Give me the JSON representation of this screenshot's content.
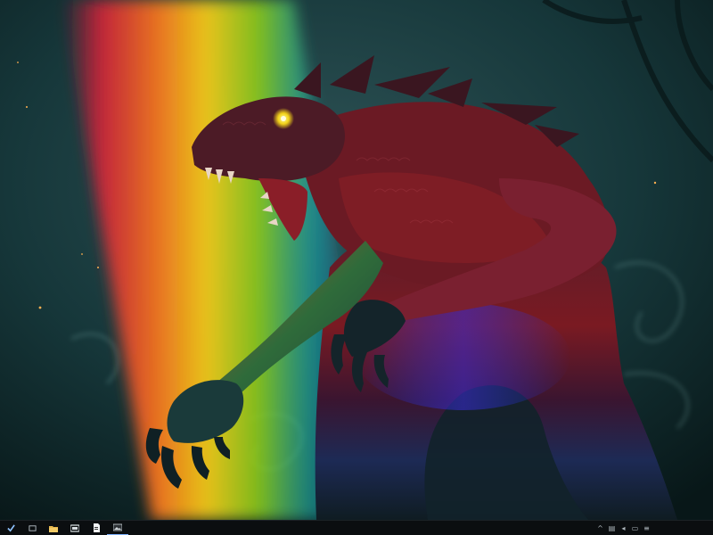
{
  "desktop": {
    "wallpaper_description_icon": "monster-wallpaper-icon"
  },
  "taskbar": {
    "start_icon": "start-menu-icon",
    "apps": [
      {
        "icon": "task-view-icon"
      },
      {
        "icon": "file-explorer-icon"
      },
      {
        "icon": "folder-icon"
      },
      {
        "icon": "document-icon"
      },
      {
        "icon": "photo-app-icon"
      }
    ],
    "tray": [
      {
        "icon": "chevron-up-icon",
        "glyph": "^"
      },
      {
        "icon": "network-icon",
        "glyph": "▤"
      },
      {
        "icon": "volume-icon",
        "glyph": "◂"
      },
      {
        "icon": "battery-icon",
        "glyph": "▭"
      },
      {
        "icon": "language-icon",
        "glyph": "≡"
      }
    ],
    "clock": {
      "line1": "",
      "line2": ""
    }
  }
}
